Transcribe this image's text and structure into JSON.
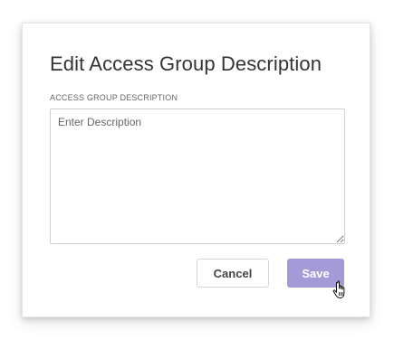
{
  "dialog": {
    "title": "Edit Access Group Description",
    "field": {
      "label": "ACCESS GROUP DESCRIPTION",
      "placeholder": "Enter Description",
      "value": ""
    },
    "buttons": {
      "cancel_label": "Cancel",
      "save_label": "Save"
    },
    "colors": {
      "accent": "#a59ad8",
      "title_text": "#333333"
    }
  },
  "pointer": {
    "icon": "hand-pointer-icon"
  }
}
